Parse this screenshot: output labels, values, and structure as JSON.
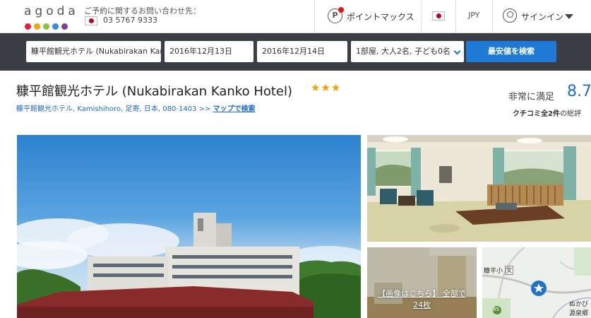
{
  "header": {
    "logo_text": "agoda",
    "logo_dot_colors": [
      "#e4222f",
      "#f5a100",
      "#8bc13f",
      "#2f8fd8",
      "#7b3fa0"
    ],
    "contact_label": "ご予約に関するお問い合わせ先：",
    "contact_phone": "03 5767 9333",
    "points_label": "ポイントマックス",
    "currency": "JPY",
    "signin_label": "サインイン"
  },
  "search": {
    "destination_value": "糠平館観光ホテル (Nukabirakan Kanko Hotel)",
    "checkin_value": "2016年12月13日",
    "checkout_value": "2016年12月14日",
    "occupancy_value": "1部屋, 大人2名, 子ども0名",
    "search_button_label": "最安値を検索"
  },
  "hotel": {
    "title": "糠平館観光ホテル (Nukabirakan Kanko Hotel)",
    "star_rating": 3,
    "stars_text": "★★★",
    "address": "糠平館観光ホテル, Kamishihoro, 足寄, 日本, 080-1403 >>",
    "map_link_label": "マップで検索",
    "rating_label": "非常に満足",
    "rating_score": "8.7",
    "review_count_bold": "クチコミ全2件",
    "review_count_suffix": "の総評"
  },
  "gallery": {
    "more_label_line1": "【画像はこちら】 全部で",
    "more_label_line2": "24枚"
  },
  "map": {
    "label_school": "糠平小",
    "label_place_1": "ぬかび",
    "label_place_2": "源泉郷",
    "road_number": "85",
    "school_symbol": "文"
  },
  "colors": {
    "search_bar_bg": "#3b3f45",
    "search_button": "#1f7ad6",
    "link_blue": "#1e6bc4",
    "star": "#f4a100",
    "score_blue": "#1e70c9"
  }
}
